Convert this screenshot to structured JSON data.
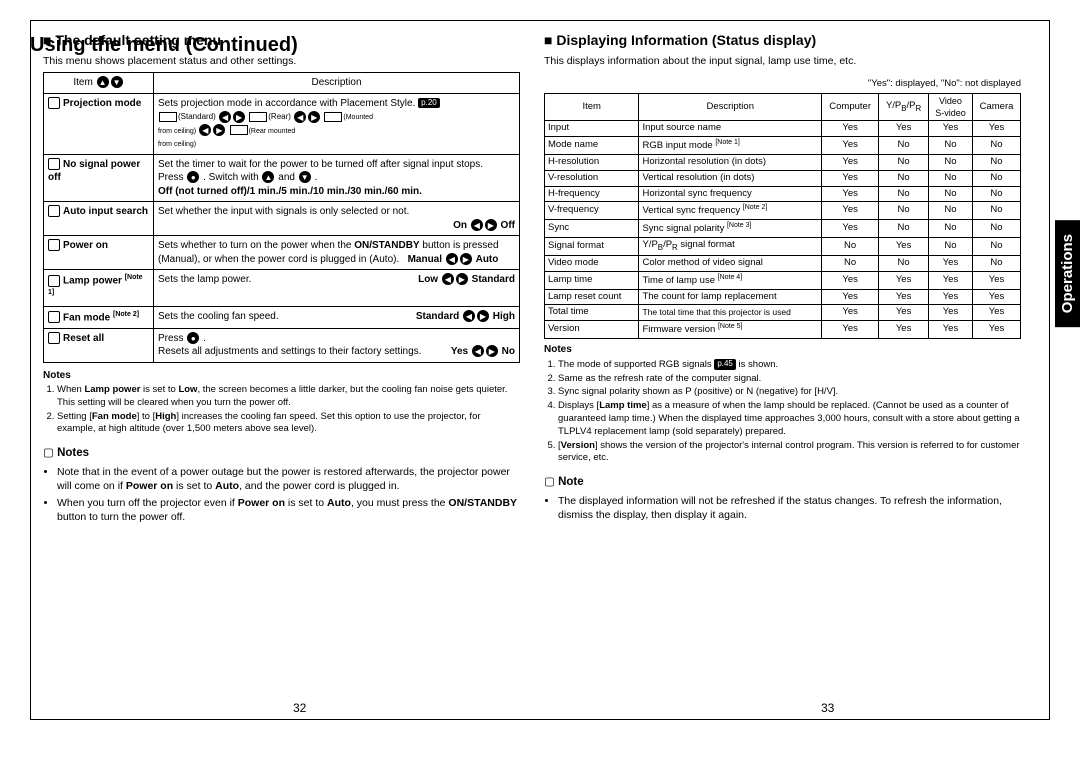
{
  "page_title": "Using the menu (Continued)",
  "left": {
    "heading": "The default setting menu",
    "intro": "This menu shows placement status and other settings.",
    "table_head": {
      "col1": "Item ▲ ▼",
      "col2": "Description"
    },
    "rows": [
      {
        "item": "Projection mode",
        "desc": "Sets projection mode in accordance with Placement Style.",
        "ref": "p.20",
        "options": "(Standard) ◀ ▶ (Rear) ◀ ▶ (Mounted from ceiling) ◀ ▶ (Rear mounted from ceiling)"
      },
      {
        "item": "No signal power off",
        "desc_line1": "Set the timer to wait for the power to be turned off after signal input stops.",
        "desc_line2": "Press ● . Switch with ▲ and ▼ .",
        "desc_line3": "Off (not turned off)/1 min./5 min./10 min./30 min./60 min."
      },
      {
        "item": "Auto input search",
        "desc": "Set whether the input with signals is only selected or not.",
        "toggle": "On ◀ ▶ Off"
      },
      {
        "item": "Power on",
        "desc": "Sets whether to turn on the power when the ON/STANDBY button is pressed (Manual), or when the power cord is plugged in (Auto).",
        "toggle": "Manual ◀ ▶ Auto"
      },
      {
        "item": "Lamp power",
        "note_mark": "[Note 1]",
        "desc": "Sets the lamp power.",
        "toggle": "Low ◀ ▶ Standard"
      },
      {
        "item": "Fan mode",
        "note_mark": "[Note 2]",
        "desc": "Sets the cooling fan speed.",
        "toggle": "Standard ◀ ▶ High"
      },
      {
        "item": "Reset all",
        "desc_line1": "Press ● .",
        "desc_line2": "Resets all adjustments and settings to their factory settings.",
        "toggle": "Yes ◀ ▶ No"
      }
    ],
    "notes_heading": "Notes",
    "notes_numbered": [
      "When Lamp power is set to Low, the screen becomes a little darker, but the cooling fan noise gets quieter. This setting will be cleared when you turn the power off.",
      "Setting [Fan mode] to [High] increases the cooling fan speed. Set this option to use the projector, for example, at high altitude (over 1,500 meters above sea level)."
    ],
    "notes_sub_heading": "Notes",
    "bullets": [
      "Note that in the event of a power outage but the power is restored afterwards, the projector power will come on if Power on is set to Auto, and the power cord is plugged in.",
      "When you turn off the projector even if Power on is set to Auto, you must press the ON/STANDBY button to turn the power off."
    ],
    "page_num": "32"
  },
  "right": {
    "heading": "Displaying Information (Status display)",
    "intro": "This displays information about the input signal, lamp use time, etc.",
    "legend": "\"Yes\": displayed, \"No\": not displayed",
    "table_head": [
      "Item",
      "Description",
      "Computer",
      "Y/PB/PR",
      "Video S-video",
      "Camera"
    ],
    "rows": [
      {
        "item": "Input",
        "desc": "Input source name",
        "v": [
          "Yes",
          "Yes",
          "Yes",
          "Yes"
        ]
      },
      {
        "item": "Mode name",
        "desc": "RGB input mode",
        "note": "[Note 1]",
        "v": [
          "Yes",
          "No",
          "No",
          "No"
        ]
      },
      {
        "item": "H-resolution",
        "desc": "Horizontal resolution (in dots)",
        "v": [
          "Yes",
          "No",
          "No",
          "No"
        ]
      },
      {
        "item": "V-resolution",
        "desc": "Vertical resolution (in dots)",
        "v": [
          "Yes",
          "No",
          "No",
          "No"
        ]
      },
      {
        "item": "H-frequency",
        "desc": "Horizontal sync frequency",
        "v": [
          "Yes",
          "No",
          "No",
          "No"
        ]
      },
      {
        "item": "V-frequency",
        "desc": "Vertical sync frequency",
        "note": "[Note 2]",
        "v": [
          "Yes",
          "No",
          "No",
          "No"
        ]
      },
      {
        "item": "Sync",
        "desc": "Sync signal polarity",
        "note": "[Note 3]",
        "v": [
          "Yes",
          "No",
          "No",
          "No"
        ]
      },
      {
        "item": "Signal format",
        "desc": "Y/PB/PR signal format",
        "v": [
          "No",
          "Yes",
          "No",
          "No"
        ]
      },
      {
        "item": "Video mode",
        "desc": "Color method of video signal",
        "v": [
          "No",
          "No",
          "Yes",
          "No"
        ]
      },
      {
        "item": "Lamp time",
        "desc": "Time of lamp use",
        "note": "[Note 4]",
        "v": [
          "Yes",
          "Yes",
          "Yes",
          "Yes"
        ]
      },
      {
        "item": "Lamp reset count",
        "desc": "The count for lamp replacement",
        "v": [
          "Yes",
          "Yes",
          "Yes",
          "Yes"
        ]
      },
      {
        "item": "Total time",
        "desc": "The total time that this projector is used",
        "v": [
          "Yes",
          "Yes",
          "Yes",
          "Yes"
        ]
      },
      {
        "item": "Version",
        "desc": "Firmware version",
        "note": "[Note 5]",
        "v": [
          "Yes",
          "Yes",
          "Yes",
          "Yes"
        ]
      }
    ],
    "notes_heading": "Notes",
    "notes_numbered": [
      "The mode of supported RGB signals p.45 is shown.",
      "Same as the refresh rate of the computer signal.",
      "Sync signal polarity shown as P (positive) or N (negative) for [H/V].",
      "Displays [Lamp time] as a measure of when the lamp should be replaced. (Cannot be used as a counter of guaranteed lamp time.) When the displayed time approaches 3,000 hours, consult with a store about getting a TLPLV4 replacement lamp (sold separately) prepared.",
      "[Version] shows the version of the projector's internal control program. This version is referred to for customer service, etc."
    ],
    "note_sub_heading": "Note",
    "bullet": "The displayed information will not be refreshed if the status changes. To refresh the information, dismiss the display, then display it again.",
    "page_num": "33"
  },
  "sidebar_tab": "Operations"
}
